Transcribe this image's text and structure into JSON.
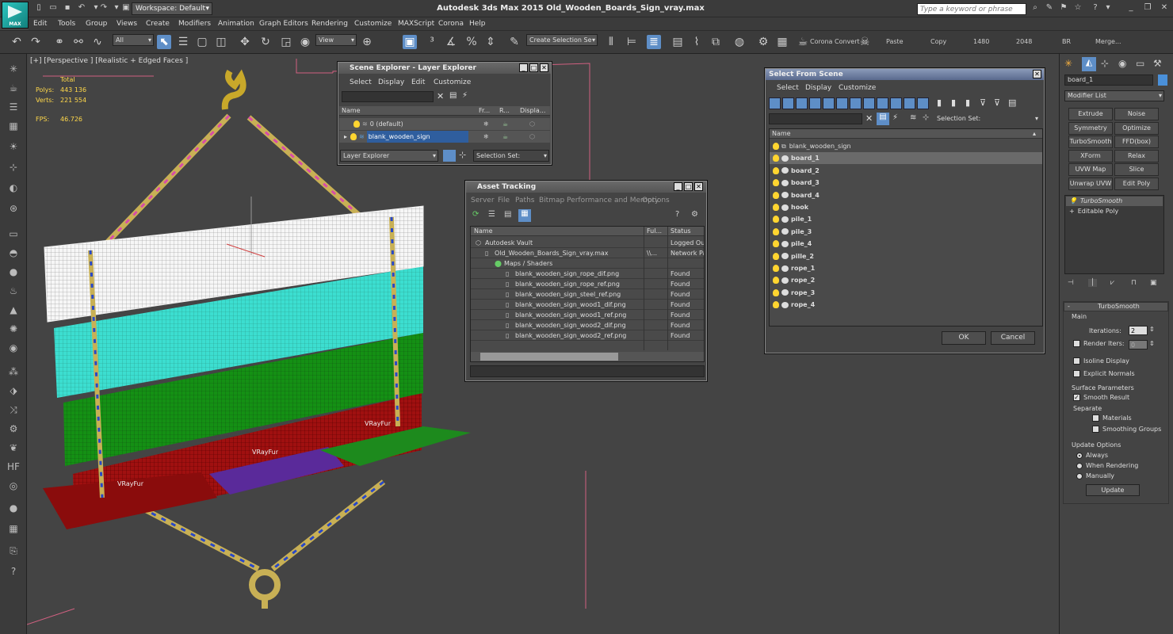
{
  "app": {
    "window_title": "Autodesk 3ds Max  2015     Old_Wooden_Boards_Sign_vray.max",
    "logo_label": "MAX",
    "workspace": "Workspace: Default",
    "search_placeholder": "Type a keyword or phrase"
  },
  "menu": [
    "Edit",
    "Tools",
    "Group",
    "Views",
    "Create",
    "Modifiers",
    "Animation",
    "Graph Editors",
    "Rendering",
    "Customize",
    "MAXScript",
    "Corona",
    "Help"
  ],
  "toolbar": {
    "filter": "All",
    "refcoord": "View",
    "selection_set": "Create Selection Se",
    "corona_convert": "Corona Convert",
    "paste": "Paste",
    "copy": "Copy",
    "v1480": "1480",
    "v2048": "2048",
    "br": "BR",
    "merge": "Merge..."
  },
  "viewport": {
    "label": "[+] [Perspective ] [Realistic + Edged Faces ]",
    "total": "Total",
    "polys_label": "Polys:",
    "polys": "443 136",
    "verts_label": "Verts:",
    "verts": "221 554",
    "fps_label": "FPS:",
    "fps": "46.726",
    "vrayfur1": "VRayFur",
    "vrayfur2": "VRayFur",
    "vrayfur3": "VRayFur"
  },
  "scene_explorer": {
    "title": "Scene Explorer - Layer Explorer",
    "menu": [
      "Select",
      "Display",
      "Edit",
      "Customize"
    ],
    "col_name": "Name",
    "col_fr": "Fr...",
    "col_r": "R...",
    "col_disp": "Displa...",
    "rows": [
      "0 (default)",
      "blank_wooden_sign"
    ],
    "footer_dd": "Layer Explorer",
    "footer_sel": "Selection Set:"
  },
  "asset_tracking": {
    "title": "Asset Tracking",
    "menu": [
      "Server",
      "File",
      "Paths",
      "Bitmap Performance and Memory",
      "Options"
    ],
    "col_name": "Name",
    "col_full": "Ful...",
    "col_status": "Status",
    "rows": [
      {
        "name": "Autodesk Vault",
        "full": "",
        "status": "Logged Out"
      },
      {
        "name": "Old_Wooden_Boards_Sign_vray.max",
        "full": "\\\\...",
        "status": "Network Pa"
      },
      {
        "name": "Maps / Shaders",
        "full": "",
        "status": ""
      },
      {
        "name": "blank_wooden_sign_rope_dif.png",
        "full": "",
        "status": "Found"
      },
      {
        "name": "blank_wooden_sign_rope_ref.png",
        "full": "",
        "status": "Found"
      },
      {
        "name": "blank_wooden_sign_steel_ref.png",
        "full": "",
        "status": "Found"
      },
      {
        "name": "blank_wooden_sign_wood1_dif.png",
        "full": "",
        "status": "Found"
      },
      {
        "name": "blank_wooden_sign_wood1_ref.png",
        "full": "",
        "status": "Found"
      },
      {
        "name": "blank_wooden_sign_wood2_dif.png",
        "full": "",
        "status": "Found"
      },
      {
        "name": "blank_wooden_sign_wood2_ref.png",
        "full": "",
        "status": "Found"
      }
    ]
  },
  "select_from_scene": {
    "title": "Select From Scene",
    "menu": [
      "Select",
      "Display",
      "Customize"
    ],
    "selection_set": "Selection Set:",
    "col_name": "Name",
    "items": [
      "blank_wooden_sign",
      "board_1",
      "board_2",
      "board_3",
      "board_4",
      "hook",
      "pile_1",
      "pile_3",
      "pile_4",
      "pille_2",
      "rope_1",
      "rope_2",
      "rope_3",
      "rope_4"
    ],
    "ok": "OK",
    "cancel": "Cancel"
  },
  "command_panel": {
    "object_name": "board_1",
    "modifier_list": "Modifier List",
    "buttons": [
      "Extrude",
      "Noise",
      "Symmetry",
      "Optimize",
      "TurboSmooth",
      "FFD(box)",
      "XForm",
      "Relax",
      "UVW Map",
      "Slice",
      "Unwrap UVW",
      "Edit Poly"
    ],
    "stack": [
      "TurboSmooth",
      "Editable Poly"
    ],
    "rollout": "TurboSmooth",
    "main": "Main",
    "iterations_label": "Iterations:",
    "iterations": "2",
    "render_iters_label": "Render Iters:",
    "render_iters": "0",
    "isoline": "Isoline Display",
    "explicit_normals": "Explicit Normals",
    "surface_params": "Surface Parameters",
    "smooth_result": "Smooth Result",
    "separate": "Separate",
    "materials": "Materials",
    "smoothing_groups": "Smoothing Groups",
    "update_options": "Update Options",
    "always": "Always",
    "when_rendering": "When Rendering",
    "manually": "Manually",
    "update": "Update"
  }
}
